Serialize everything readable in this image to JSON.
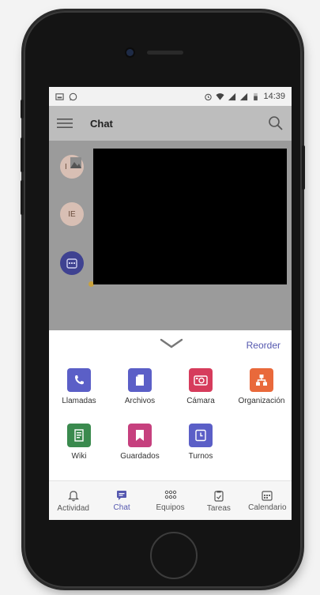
{
  "status_bar": {
    "time": "14:39",
    "left_icons": [
      "image-icon",
      "whatsapp-icon"
    ],
    "right_icons": [
      "alarm-icon",
      "wifi-icon",
      "signal-icon",
      "signal-icon",
      "battery-icon"
    ]
  },
  "header": {
    "menu_icon": "hamburger-icon",
    "title": "Chat",
    "search_icon": "search-icon"
  },
  "chat_list": {
    "avatars": [
      {
        "initials": "I",
        "kind": "photo"
      },
      {
        "initials": "IE",
        "kind": "initials"
      },
      {
        "initials": "",
        "kind": "calendar"
      }
    ]
  },
  "sheet": {
    "collapse_icon": "chevron-down-icon",
    "reorder_label": "Reorder",
    "apps": [
      {
        "label": "Llamadas",
        "icon": "phone-icon",
        "color": "#5b5fc7"
      },
      {
        "label": "Archivos",
        "icon": "file-icon",
        "color": "#5b5fc7"
      },
      {
        "label": "Cámara",
        "icon": "camera-icon",
        "color": "#d63c5c"
      },
      {
        "label": "Organización",
        "icon": "org-chart-icon",
        "color": "#e9693b"
      },
      {
        "label": "Wiki",
        "icon": "wiki-icon",
        "color": "#3a8a4e"
      },
      {
        "label": "Guardados",
        "icon": "bookmark-icon",
        "color": "#c6407e"
      },
      {
        "label": "Turnos",
        "icon": "clock-icon",
        "color": "#5b5fc7"
      }
    ]
  },
  "tabs": [
    {
      "label": "Actividad",
      "icon": "bell-icon",
      "active": false
    },
    {
      "label": "Chat",
      "icon": "chat-icon",
      "active": true
    },
    {
      "label": "Equipos",
      "icon": "teams-icon",
      "active": false
    },
    {
      "label": "Tareas",
      "icon": "tasks-icon",
      "active": false
    },
    {
      "label": "Calendario",
      "icon": "calendar-icon",
      "active": false
    }
  ],
  "colors": {
    "accent": "#5558af",
    "overlay": "#9b9b9b"
  }
}
